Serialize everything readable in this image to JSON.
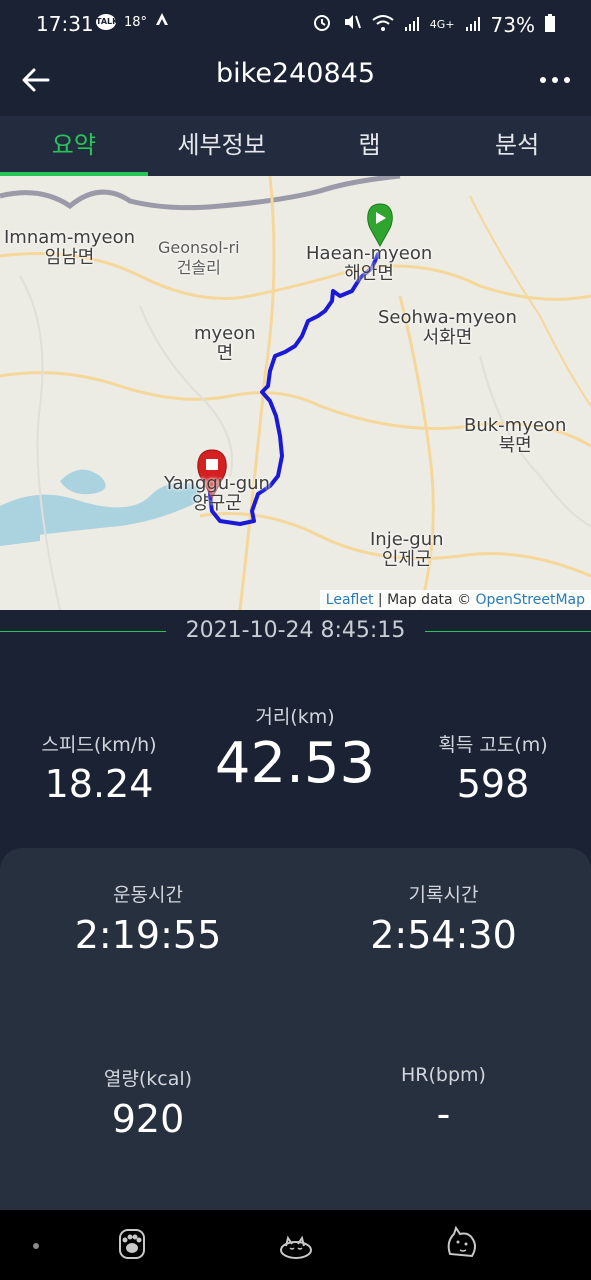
{
  "status_bar": {
    "time": "17:31",
    "talk_icon_text": "TALK",
    "temperature": "18°",
    "battery_percent": "73%",
    "network": "4G+"
  },
  "header": {
    "title": "bike240845"
  },
  "tabs": [
    {
      "label": "요약",
      "active": true
    },
    {
      "label": "세부정보",
      "active": false
    },
    {
      "label": "랩",
      "active": false
    },
    {
      "label": "분석",
      "active": false
    }
  ],
  "map": {
    "places": [
      {
        "name": "Imnam-myeon",
        "local": "임남면"
      },
      {
        "name": "Geonsol-ri",
        "local": "건솔리"
      },
      {
        "name": "Haean-myeon",
        "local": "해안면"
      },
      {
        "name": "myeon",
        "local": "면"
      },
      {
        "name": "Seohwa-myeon",
        "local": "서화면"
      },
      {
        "name": "Buk-myeon",
        "local": "북면"
      },
      {
        "name": "Yanggu-gun",
        "local": "양구군"
      },
      {
        "name": "Inje-gun",
        "local": "인제군"
      }
    ],
    "attribution": {
      "leaflet": "Leaflet",
      "separator": " | Map data © ",
      "osm": "OpenStreetMap"
    },
    "route_color": "#1a1ad6",
    "start_marker_color": "#2fa52f",
    "end_marker_color": "#d42020"
  },
  "summary": {
    "datetime": "2021-10-24 8:45:15",
    "distance": {
      "label": "거리(km)",
      "value": "42.53"
    },
    "speed": {
      "label": "스피드(km/h)",
      "value": "18.24"
    },
    "elevation_gain": {
      "label": "획득 고도(m)",
      "value": "598"
    }
  },
  "details": {
    "moving_time": {
      "label": "운동시간",
      "value": "2:19:55"
    },
    "elapsed_time": {
      "label": "기록시간",
      "value": "2:54:30"
    },
    "calories": {
      "label": "열량(kcal)",
      "value": "920"
    },
    "heart_rate": {
      "label": "HR(bpm)",
      "value": "-"
    }
  },
  "colors": {
    "accent": "#27c45a",
    "background": "#1a2233",
    "card": "#27303f"
  },
  "bottom_nav": {
    "items": [
      "paw-icon",
      "sleeping-cat-icon",
      "cat-face-icon"
    ]
  }
}
